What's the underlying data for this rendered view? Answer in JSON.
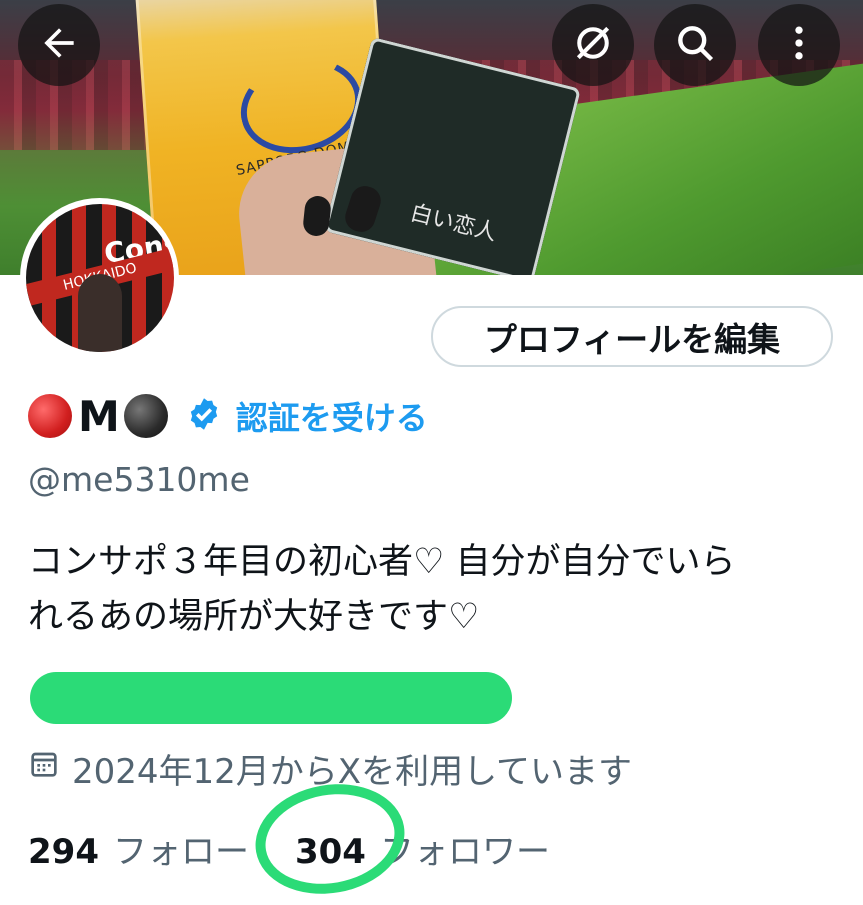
{
  "banner": {
    "cup_text": "SAPPORO DOME",
    "packet_text": "白い恋人"
  },
  "header": {
    "back_label": "Back",
    "grok_label": "Grok",
    "search_label": "Search",
    "more_label": "More"
  },
  "profile": {
    "avatar_sign": "Cons",
    "avatar_scarf": "HOKKAIDO",
    "edit_button": "プロフィールを編集",
    "name_letter": "M",
    "verify_label": "認証を受ける",
    "handle": "@me5310me",
    "bio_line1": "コンサポ３年目の初心者♡ 自分が自分でいら",
    "bio_line2": "れるあの場所が大好きです♡",
    "joined": "2024年12月からXを利用しています",
    "following_count": "294",
    "following_label": "フォロー",
    "followers_count": "304",
    "followers_label": "フォロワー"
  },
  "colors": {
    "accent": "#1d9bf0",
    "redaction": "#2bdb77",
    "muted_text": "#536471"
  }
}
